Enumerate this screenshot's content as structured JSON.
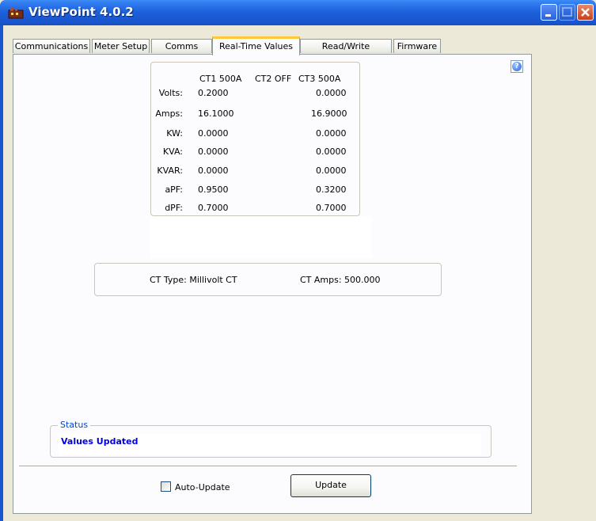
{
  "window": {
    "title": "ViewPoint 4.0.2"
  },
  "tabs": [
    {
      "label": "Communications"
    },
    {
      "label": "Meter Setup"
    },
    {
      "label": "Comms Setup"
    },
    {
      "label": "Real-Time Values"
    },
    {
      "label": "Read/Write Registers"
    },
    {
      "label": "Firmware"
    }
  ],
  "active_tab": "Real-Time Values",
  "values_table": {
    "headers": [
      "CT1 500A",
      "CT2 OFF",
      "CT3 500A"
    ],
    "rows": [
      {
        "label": "Volts:",
        "ct1": "0.2000",
        "ct3": "0.0000"
      },
      {
        "label": "Amps:",
        "ct1": "16.1000",
        "ct3": "16.9000"
      },
      {
        "label": "KW:",
        "ct1": "0.0000",
        "ct3": "0.0000"
      },
      {
        "label": "KVA:",
        "ct1": "0.0000",
        "ct3": "0.0000"
      },
      {
        "label": "KVAR:",
        "ct1": "0.0000",
        "ct3": "0.0000"
      },
      {
        "label": "aPF:",
        "ct1": "0.9500",
        "ct3": "0.3200"
      },
      {
        "label": "dPF:",
        "ct1": "0.7000",
        "ct3": "0.7000"
      }
    ]
  },
  "ct_info": {
    "type_text": "CT Type: Millivolt CT",
    "amps_text": "CT Amps: 500.000"
  },
  "status": {
    "legend": "Status",
    "value": "Values Updated"
  },
  "controls": {
    "auto_update_label": "Auto-Update",
    "auto_update_checked": false,
    "update_button": "Update"
  },
  "icons": {
    "app": "viewpoint-app-icon",
    "help": "help-icon",
    "minimize": "minimize-icon",
    "maximize": "maximize-icon",
    "close": "close-icon"
  }
}
